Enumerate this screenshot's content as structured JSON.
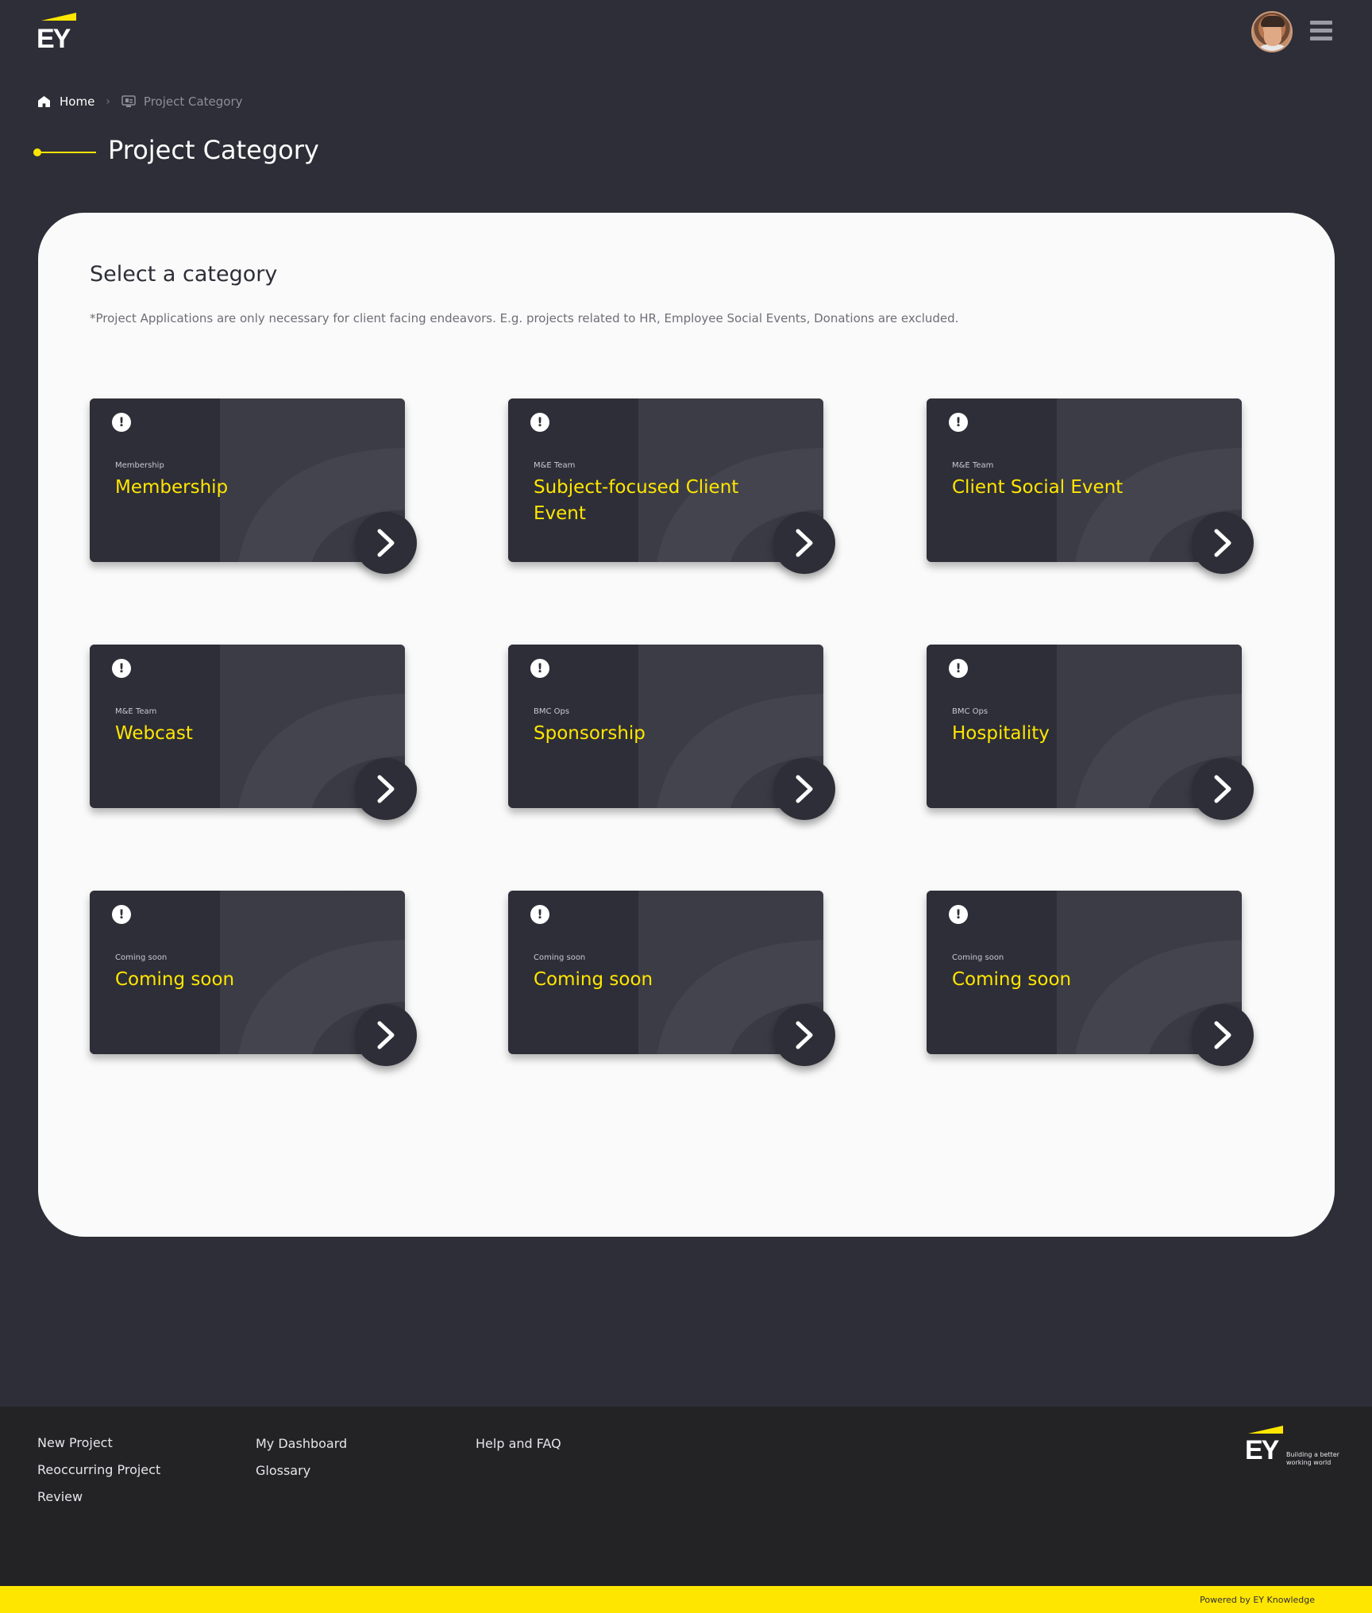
{
  "header": {
    "logo_text": "EY",
    "avatar_icon": "user-avatar",
    "menu_icon": "hamburger-menu-icon"
  },
  "breadcrumb": {
    "home": "Home",
    "separator": "›",
    "current": "Project Category"
  },
  "page": {
    "title": "Project Category"
  },
  "panel": {
    "heading": "Select a category",
    "note": "*Project Applications are only necessary for client facing endeavors. E.g. projects related to HR, Employee Social Events, Donations are excluded."
  },
  "cards": [
    {
      "sub": "Membership",
      "name": "Membership"
    },
    {
      "sub": "M&E Team",
      "name": "Subject-focused Client Event"
    },
    {
      "sub": "M&E Team",
      "name": "Client Social Event"
    },
    {
      "sub": "M&E Team",
      "name": "Webcast"
    },
    {
      "sub": "BMC Ops",
      "name": "Sponsorship"
    },
    {
      "sub": "BMC Ops",
      "name": "Hospitality"
    },
    {
      "sub": "Coming soon",
      "name": "Coming soon"
    },
    {
      "sub": "Coming soon",
      "name": "Coming soon"
    },
    {
      "sub": "Coming soon",
      "name": "Coming soon"
    }
  ],
  "footer": {
    "col1": [
      "New Project",
      "Reoccurring Project",
      "Review"
    ],
    "col2": [
      "My Dashboard",
      "Glossary"
    ],
    "col3": [
      "Help and FAQ"
    ],
    "logo_text": "EY",
    "tagline": "Building a better working world",
    "powered_by": "Powered by EY Knowledge"
  },
  "colors": {
    "background": "#2e2e38",
    "accent": "#ffe600",
    "panel": "#fafafa",
    "footer": "#232325"
  }
}
